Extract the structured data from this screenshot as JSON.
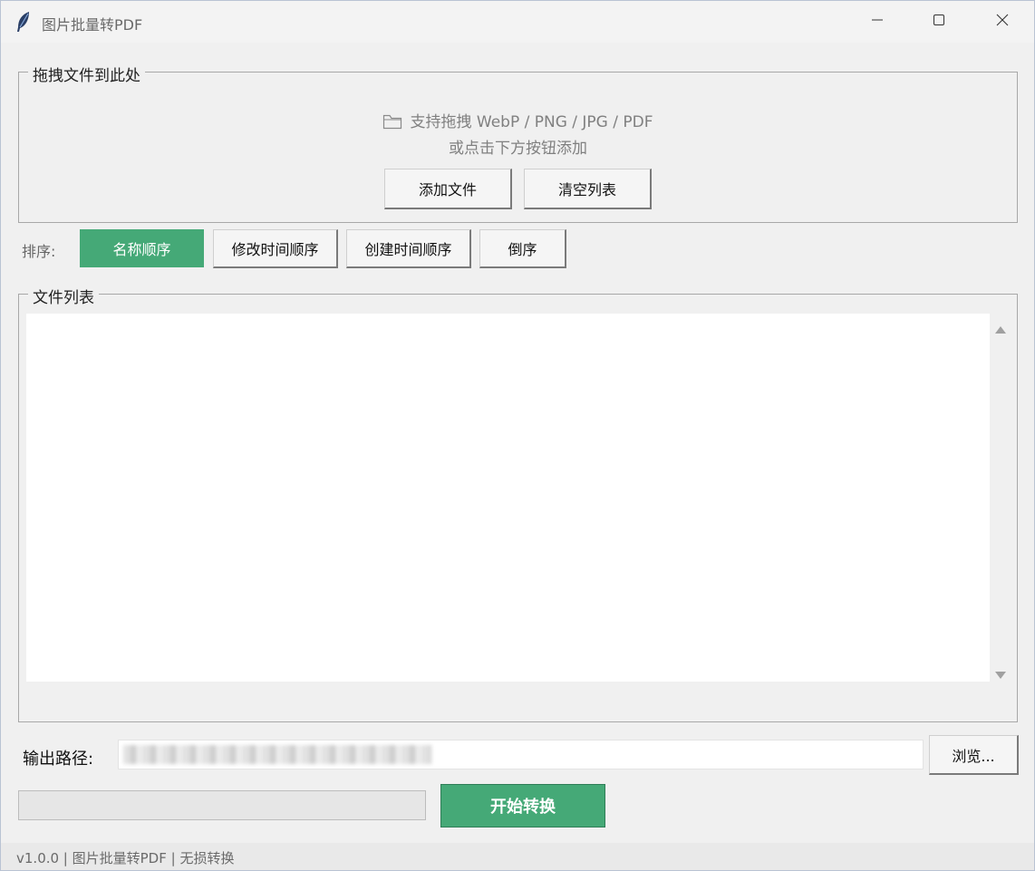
{
  "window": {
    "title": "图片批量转PDF",
    "icon": "feather-icon",
    "controls": [
      "minimize-icon",
      "maximize-icon",
      "close-icon"
    ]
  },
  "drop_zone": {
    "legend": "拖拽文件到此处",
    "line1": "支持拖拽 WebP / PNG / JPG / PDF",
    "line2": "或点击下方按钮添加",
    "icon": "folder-icon",
    "add_label": "添加文件",
    "clear_label": "清空列表"
  },
  "sort": {
    "label": "排序:",
    "options": [
      "名称顺序",
      "修改时间顺序",
      "创建时间顺序",
      "倒序"
    ],
    "selected": "名称顺序"
  },
  "file_list": {
    "legend": "文件列表",
    "items": []
  },
  "output": {
    "label": "输出路径:",
    "value": "",
    "browse_label": "浏览..."
  },
  "actions": {
    "progress": 0,
    "start_label": "开始转换"
  },
  "status": {
    "text": "v1.0.0 | 图片批量转PDF | 无损转换"
  },
  "colors": {
    "accent": "#45a977",
    "background": "#f0f0f0"
  }
}
